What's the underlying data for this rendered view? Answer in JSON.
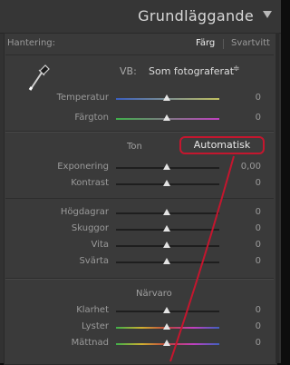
{
  "header": {
    "title": "Grundläggande"
  },
  "treatment": {
    "label": "Hantering:",
    "color": "Färg",
    "bw": "Svartvitt"
  },
  "wb": {
    "label": "VB:",
    "value": "Som fotograferat",
    "arrows": "≑"
  },
  "sliders_wb": [
    {
      "label": "Temperatur",
      "value": "0",
      "pos": 0.5
    },
    {
      "label": "Färgton",
      "value": "0",
      "pos": 0.5
    }
  ],
  "tone": {
    "title": "Ton",
    "auto": "Automatisk",
    "exposure": {
      "label": "Exponering",
      "value": "0,00",
      "pos": 0.5
    },
    "contrast": {
      "label": "Kontrast",
      "value": "0",
      "pos": 0.5
    },
    "highlights": {
      "label": "Högdagrar",
      "value": "0",
      "pos": 0.5
    },
    "shadows": {
      "label": "Skuggor",
      "value": "0",
      "pos": 0.5
    },
    "whites": {
      "label": "Vita",
      "value": "0",
      "pos": 0.5
    },
    "blacks": {
      "label": "Svärta",
      "value": "0",
      "pos": 0.5
    }
  },
  "presence": {
    "title": "Närvaro",
    "clarity": {
      "label": "Klarhet",
      "value": "0",
      "pos": 0.5
    },
    "vibrance": {
      "label": "Lyster",
      "value": "0",
      "pos": 0.5
    },
    "saturation": {
      "label": "Mättnad",
      "value": "0",
      "pos": 0.5
    }
  },
  "colors": {
    "highlight": "#c4162e",
    "panel": "#3a3a3a"
  },
  "icons": {
    "picker": "eyedropper-icon",
    "collapse": "triangle-down-icon"
  }
}
